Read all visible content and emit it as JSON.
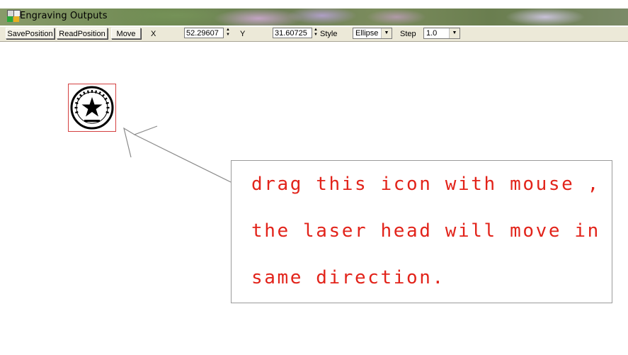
{
  "window": {
    "title": "Engraving Outputs"
  },
  "toolbar": {
    "save_position_label": "SavePosition",
    "read_position_label": "ReadPosition",
    "move_label": "Move",
    "x_label": "X",
    "x_value": "52.29607",
    "y_label": "Y",
    "y_value": "31.60725",
    "style_label": "Style",
    "style_value": "Ellipse",
    "step_label": "Step",
    "step_value": "1.0"
  },
  "canvas": {
    "drag_icon": "engraving-seal-star-icon",
    "pointer": "arrow-pointer",
    "callout": {
      "lines": [
        "drag this icon with mouse ,",
        "the laser head will move in",
        "same direction."
      ]
    }
  },
  "colors": {
    "callout_text": "#e2231a",
    "icon_frame": "#d44040",
    "toolbar_bg": "#ece9d8"
  }
}
